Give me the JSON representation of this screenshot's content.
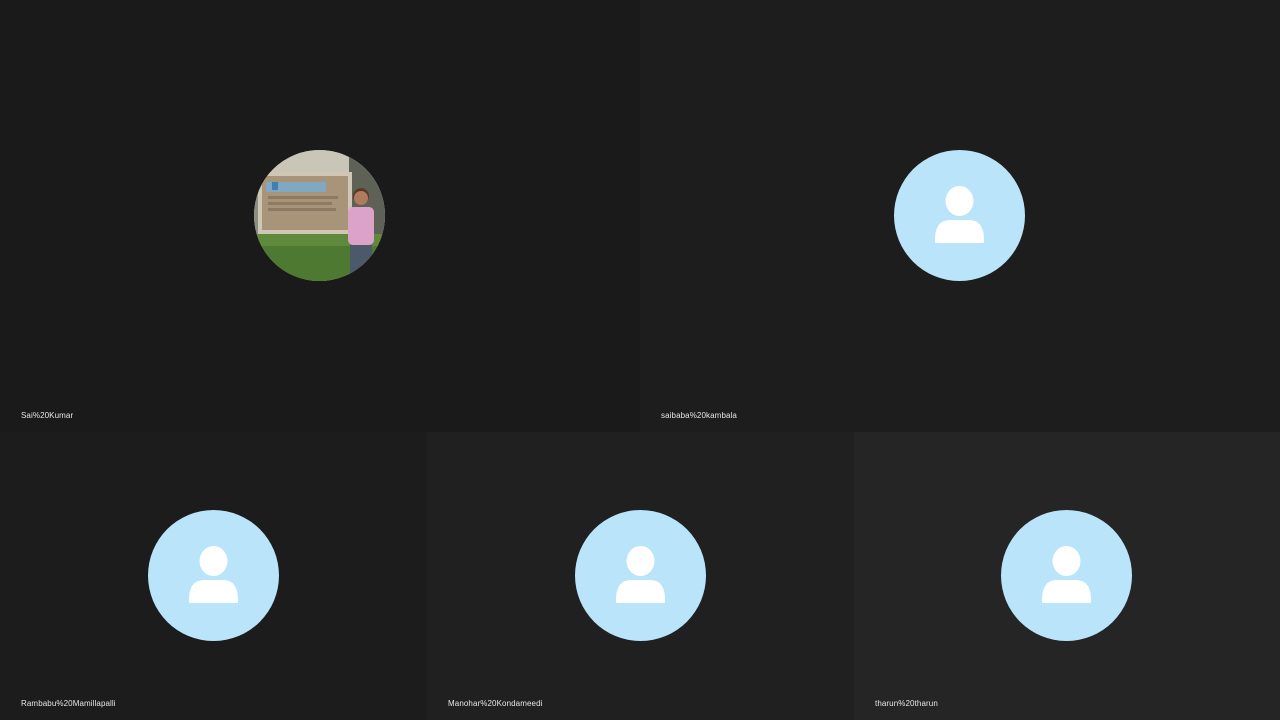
{
  "participants": [
    {
      "name": "Sai%20Kumar",
      "has_photo": true
    },
    {
      "name": "saibaba%20kambala",
      "has_photo": false
    },
    {
      "name": "Rambabu%20Mamillapalli",
      "has_photo": false
    },
    {
      "name": "Manohar%20Kondameedi",
      "has_photo": false
    },
    {
      "name": "tharun%20tharun",
      "has_photo": false
    }
  ],
  "colors": {
    "avatar_bg": "#b9e4f9",
    "avatar_glyph": "#ffffff",
    "name_text": "#e6e6e6"
  },
  "icons": {
    "default_avatar": "person-icon"
  }
}
